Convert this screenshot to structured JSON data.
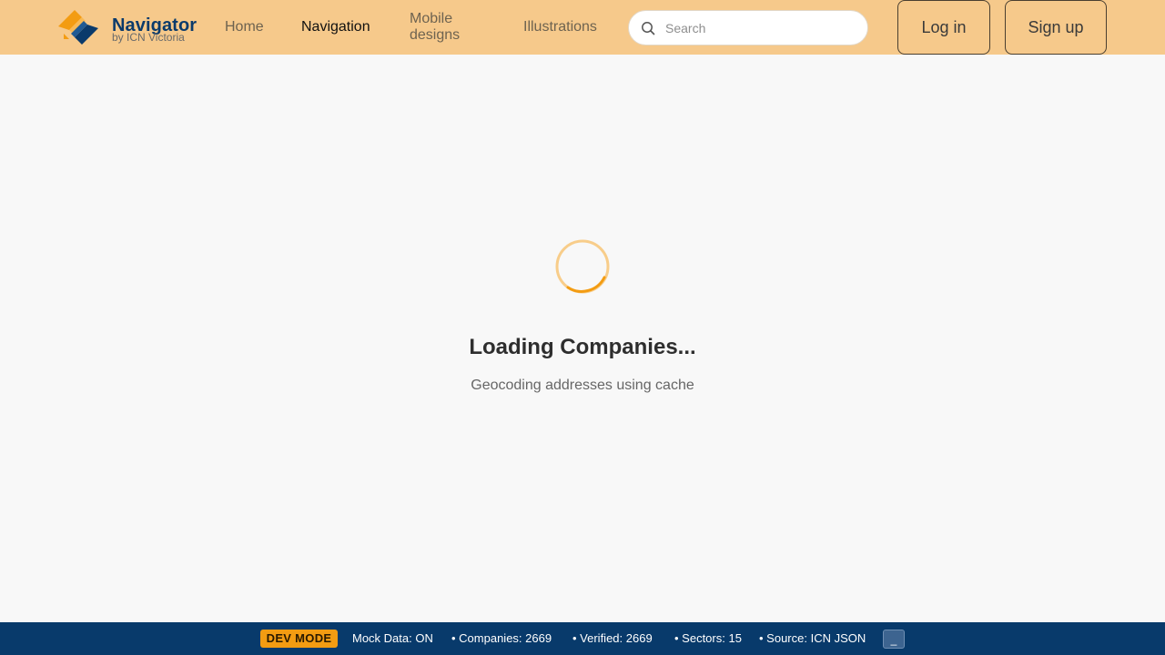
{
  "header": {
    "logo": {
      "title": "Navigator",
      "subtitle": "by ICN Victoria"
    },
    "nav": [
      {
        "label": "Home",
        "active": false
      },
      {
        "label": "Navigation",
        "active": true
      },
      {
        "label": "Mobile designs",
        "active": false
      },
      {
        "label": "Illustrations",
        "active": false
      }
    ],
    "search": {
      "placeholder": "Search",
      "value": ""
    },
    "login_label": "Log in",
    "signup_label": "Sign up",
    "background_color": "#f6c98b"
  },
  "loading": {
    "title": "Loading Companies...",
    "subtitle": "Geocoding addresses using cache",
    "spinner_color": "#f39c12"
  },
  "devbar": {
    "badge": "DEV MODE",
    "mock": "Mock Data: ON",
    "companies": "• Companies: 2669",
    "verified": "• Verified: 2669",
    "sectors": "• Sectors: 15",
    "source": "• Source: ICN JSON",
    "minimize_label": "_",
    "background_color": "#083a6b",
    "badge_color": "#f39c12"
  }
}
